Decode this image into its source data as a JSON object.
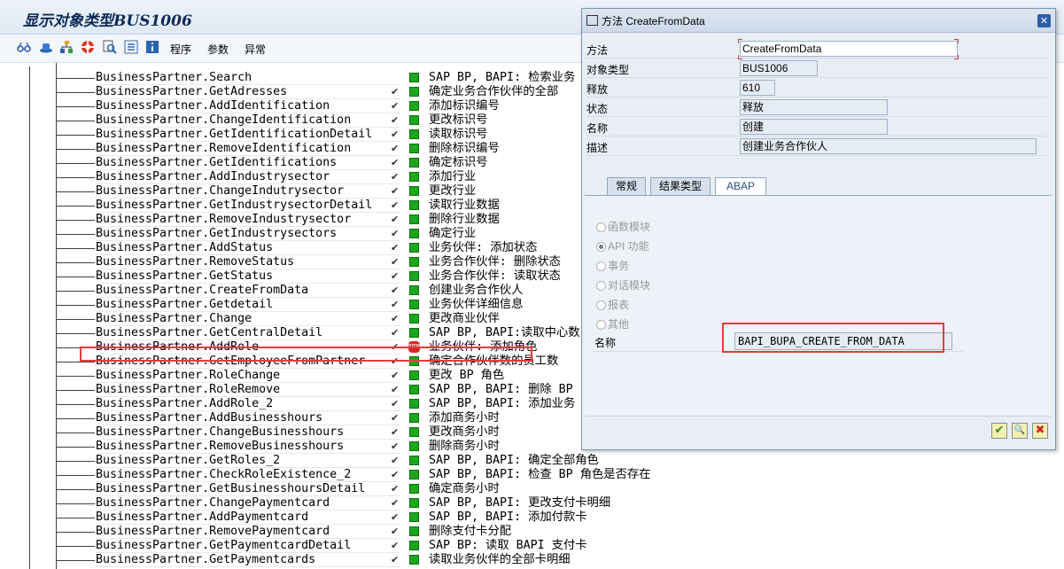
{
  "window": {
    "title": "显示对象类型BUS1006"
  },
  "toolbar": {
    "icons": [
      "glasses-icon",
      "hat-icon",
      "hierarchy-icon",
      "lifebuoy-icon",
      "search-doc-icon",
      "list-icon",
      "info-icon"
    ],
    "menu": [
      "程序",
      "参数",
      "异常"
    ]
  },
  "methods": [
    {
      "name": "BusinessPartner.Search",
      "desc": "SAP BP, BAPI: 检索业务",
      "status": "green",
      "check": ""
    },
    {
      "name": "BusinessPartner.GetAdresses",
      "desc": "确定业务合作伙伴的全部",
      "status": "green",
      "check": "✔"
    },
    {
      "name": "BusinessPartner.AddIdentification",
      "desc": "添加标识编号",
      "status": "green",
      "check": "✔"
    },
    {
      "name": "BusinessPartner.ChangeIdentification",
      "desc": "更改标识号",
      "status": "green",
      "check": "✔"
    },
    {
      "name": "BusinessPartner.GetIdentificationDetail",
      "desc": "读取标识号",
      "status": "green",
      "check": "✔"
    },
    {
      "name": "BusinessPartner.RemoveIdentification",
      "desc": "删除标识编号",
      "status": "green",
      "check": "✔"
    },
    {
      "name": "BusinessPartner.GetIdentifications",
      "desc": "确定标识号",
      "status": "green",
      "check": "✔"
    },
    {
      "name": "BusinessPartner.AddIndustrysector",
      "desc": "添加行业",
      "status": "green",
      "check": "✔"
    },
    {
      "name": "BusinessPartner.ChangeIndutrysector",
      "desc": "更改行业",
      "status": "green",
      "check": "✔"
    },
    {
      "name": "BusinessPartner.GetIndustrysectorDetail",
      "desc": "读取行业数据",
      "status": "green",
      "check": "✔"
    },
    {
      "name": "BusinessPartner.RemoveIndustrysector",
      "desc": "删除行业数据",
      "status": "green",
      "check": "✔"
    },
    {
      "name": "BusinessPartner.GetIndustrysectors",
      "desc": "确定行业",
      "status": "green",
      "check": "✔"
    },
    {
      "name": "BusinessPartner.AddStatus",
      "desc": "业务伙伴: 添加状态",
      "status": "green",
      "check": "✔"
    },
    {
      "name": "BusinessPartner.RemoveStatus",
      "desc": "业务合作伙伴: 删除状态",
      "status": "green",
      "check": "✔"
    },
    {
      "name": "BusinessPartner.GetStatus",
      "desc": "业务合作伙伴: 读取状态",
      "status": "green",
      "check": "✔"
    },
    {
      "name": "BusinessPartner.CreateFromData",
      "desc": "创建业务合作伙人",
      "status": "green",
      "check": "✔"
    },
    {
      "name": "BusinessPartner.Getdetail",
      "desc": "业务伙伴详细信息",
      "status": "green",
      "check": "✔"
    },
    {
      "name": "BusinessPartner.Change",
      "desc": "更改商业伙伴",
      "status": "green",
      "check": "✔"
    },
    {
      "name": "BusinessPartner.GetCentralDetail",
      "desc": "SAP BP, BAPI:读取中心数",
      "status": "green",
      "check": "✔"
    },
    {
      "name": "BusinessPartner.AddRole",
      "desc": "业务伙伴: 添加角色",
      "status": "stop",
      "check": "✔"
    },
    {
      "name": "BusinessPartner.GetEmployeeFromPartner",
      "desc": "确定合作伙伴数的员工数",
      "status": "green",
      "check": "✔"
    },
    {
      "name": "BusinessPartner.RoleChange",
      "desc": "更改 BP 角色",
      "status": "green",
      "check": "✔"
    },
    {
      "name": "BusinessPartner.RoleRemove",
      "desc": "SAP BP, BAPI: 删除 BP",
      "status": "green",
      "check": "✔"
    },
    {
      "name": "BusinessPartner.AddRole_2",
      "desc": "SAP BP, BAPI: 添加业务",
      "status": "green",
      "check": "✔"
    },
    {
      "name": "BusinessPartner.AddBusinesshours",
      "desc": "添加商务小时",
      "status": "green",
      "check": "✔"
    },
    {
      "name": "BusinessPartner.ChangeBusinesshours",
      "desc": "更改商务小时",
      "status": "green",
      "check": "✔"
    },
    {
      "name": "BusinessPartner.RemoveBusinesshours",
      "desc": "删除商务小时",
      "status": "green",
      "check": "✔"
    },
    {
      "name": "BusinessPartner.GetRoles_2",
      "desc": "SAP BP, BAPI: 确定全部角色",
      "status": "green",
      "check": "✔"
    },
    {
      "name": "BusinessPartner.CheckRoleExistence_2",
      "desc": "SAP BP, BAPI: 检查 BP 角色是否存在",
      "status": "green",
      "check": "✔"
    },
    {
      "name": "BusinessPartner.GetBusinesshoursDetail",
      "desc": "确定商务小时",
      "status": "green",
      "check": "✔"
    },
    {
      "name": "BusinessPartner.ChangePaymentcard",
      "desc": "SAP BP, BAPI: 更改支付卡明细",
      "status": "green",
      "check": "✔"
    },
    {
      "name": "BusinessPartner.AddPaymentcard",
      "desc": "SAP BP, BAPI: 添加付款卡",
      "status": "green",
      "check": "✔"
    },
    {
      "name": "BusinessPartner.RemovePaymentcard",
      "desc": "删除支付卡分配",
      "status": "green",
      "check": "✔"
    },
    {
      "name": "BusinessPartner.GetPaymentcardDetail",
      "desc": "SAP BP: 读取 BAPI 支付卡",
      "status": "green",
      "check": "✔"
    },
    {
      "name": "BusinessPartner.GetPaymentcards",
      "desc": "读取业务伙伴的全部卡明细",
      "status": "green",
      "check": "✔"
    }
  ],
  "dialog": {
    "title": "方法 CreateFromData",
    "fields": [
      {
        "label": "方法",
        "value": "CreateFromData"
      },
      {
        "label": "对象类型",
        "value": "BUS1006"
      },
      {
        "label": "释放",
        "value": "610"
      },
      {
        "label": "状态",
        "value": "释放"
      },
      {
        "label": "名称",
        "value": "创建"
      },
      {
        "label": "描述",
        "value": "创建业务合作伙人"
      }
    ],
    "tabs": [
      "常规",
      "结果类型",
      "ABAP"
    ],
    "active_tab": "ABAP",
    "radios": [
      "函数模块",
      "API 功能",
      "事务",
      "对话模块",
      "报表",
      "其他"
    ],
    "selected_radio": "API 功能",
    "name_label": "名称",
    "function_module": "BAPI_BUPA_CREATE_FROM_DATA",
    "close_glyph": "✕",
    "buttons": {
      "confirm": "✔",
      "search": "🔍",
      "cancel": "✖"
    }
  },
  "colors": {
    "highlight": "#e63b3b",
    "led_green": "#1ca71c",
    "title_blue": "#0c2a55",
    "dialog_bg": "#e9eef5"
  }
}
